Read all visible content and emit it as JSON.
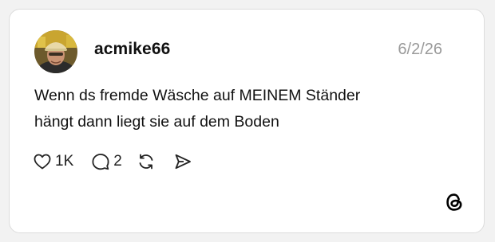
{
  "post": {
    "username": "acmike66",
    "date": "6/2/26",
    "text_lines": [
      "Wenn ds fremde Wäsche auf MEINEM Ständer",
      "hängt dann liegt sie auf dem Boden"
    ],
    "likes": "1K",
    "replies": "2"
  },
  "icons": {
    "like": "heart-icon",
    "reply": "speech-bubble-icon",
    "repost": "repost-icon",
    "share": "send-icon",
    "brand": "threads-logo-icon"
  },
  "colors": {
    "text": "#111111",
    "muted": "#9a9a9a",
    "border": "#dcdcdc",
    "background": "#f2f2f2"
  }
}
